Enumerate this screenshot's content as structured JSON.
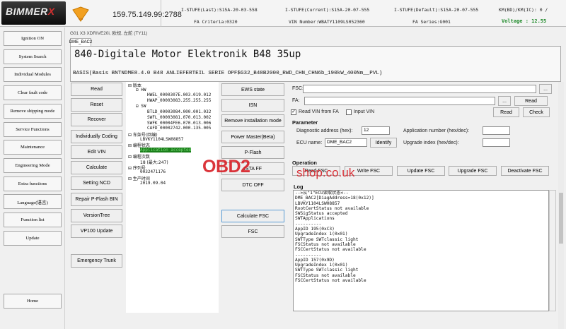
{
  "header": {
    "logo_text": "BIMMER",
    "logo_x": "X",
    "badge": "VIN",
    "ip": "159.75.149.99:2788",
    "istufe_last": "I-STUFE(Last):S15A-20-03-558",
    "istufe_current": "I-STUFE(Current):S15A-20-07-555",
    "istufe_default": "I-STUFE(Default):S15A-20-07-555",
    "km": "KM(BD)/KM(IC): 0 /",
    "fa_criteria": "FA Criteria:0320",
    "vin_number": "VIN Number:WBATY1109LS052360",
    "fa_series": "FA Series:G001",
    "voltage": "Voltage : 12.55"
  },
  "sidebar": {
    "items": [
      {
        "label": "Ignition ON"
      },
      {
        "label": "System Search"
      },
      {
        "label": "Individual Modules"
      },
      {
        "label": "Clear fault code"
      },
      {
        "label": "Remove shipping mode"
      },
      {
        "label": "Service Functions"
      },
      {
        "label": "Maintenance"
      },
      {
        "label": "Engineering Mode"
      },
      {
        "label": "Extra functions"
      },
      {
        "label": "Language(语言)"
      },
      {
        "label": "Function list"
      },
      {
        "label": "Update"
      },
      {
        "label": "Home"
      }
    ]
  },
  "vehicle": {
    "line": "G01 X3 XDRIVE20i, 欧规, 左舵 (TY11)",
    "tab": "DME_BAC2"
  },
  "ecu": {
    "title": "840-Digitale Motor Elektronik B48 35up",
    "basis": "BASIS(Basis BNTNDME8.4.0 B48 ANLIEFERTEIL SERIE OPF$G32_B48B2000_RWD_CHN_CHN6b_190kW_400Nm__PVL)"
  },
  "col1": {
    "buttons": [
      {
        "label": "Read"
      },
      {
        "label": "Reset"
      },
      {
        "label": "Recover"
      },
      {
        "label": "Individually Coding"
      },
      {
        "label": "Edit VIN"
      },
      {
        "label": "Calculate"
      },
      {
        "label": "Setting NCD"
      },
      {
        "label": "Repair P-Flash BIN"
      },
      {
        "label": "VersionTree"
      },
      {
        "label": "VP100 Update"
      },
      {
        "label": "Emergency Trunk"
      }
    ]
  },
  "tree": {
    "lines": [
      {
        "text": "⊟ 版本"
      },
      {
        "text": "⊟ HW"
      },
      {
        "text": "HWEL_0000307E.003.019.012"
      },
      {
        "text": "HWAP_00003083.255.255.255"
      },
      {
        "text": "⊟ SW"
      },
      {
        "text": "BTLD_00003084.000.001.032"
      },
      {
        "text": "SWFL_00003081.070.013.002"
      },
      {
        "text": "SWFK_00004FE6.070.013.006"
      },
      {
        "text": "CAFD_00002742.000.135.005"
      },
      {
        "text": "⊟ 车架号(回编)"
      },
      {
        "text": "LBVKY1104LSW08857"
      },
      {
        "text": "⊟ 编程状态"
      },
      {
        "text": "Application accepted"
      },
      {
        "text": "⊟ 编程次数"
      },
      {
        "text": "18 (最大:247)"
      },
      {
        "text": "⊟ 序列号"
      },
      {
        "text": "0032471176"
      },
      {
        "text": "⊟ 生产时间"
      },
      {
        "text": "2019.09.04"
      }
    ]
  },
  "col3": {
    "buttons": [
      {
        "label": "EWS state"
      },
      {
        "label": "ISN"
      },
      {
        "label": "Remove installation mode"
      },
      {
        "label": "Power Master(Beta)"
      },
      {
        "label": "P-Flash"
      },
      {
        "label": "ISTA FF"
      },
      {
        "label": "DTC OFF"
      },
      {
        "label": "Calculate FSC"
      },
      {
        "label": "FSC"
      }
    ]
  },
  "right": {
    "fsc_label": "FSC:",
    "fa_label": "FA:",
    "ellipsis": "...",
    "read": "Read",
    "check": "Check",
    "read_vin_fa": "Read VIN from FA",
    "input_vin": "Input VIN",
    "parameter": "Parameter",
    "diag_addr_label": "Diagnostic address (hex):",
    "diag_addr": "12",
    "app_num_label": "Application number (hex/dec):",
    "ecu_name_label": "ECU name:",
    "ecu_name": "DME_BAC2",
    "identify": "Identify",
    "upgrade_idx_label": "Upgrade index (hex/dec):",
    "operation": "Operation",
    "op_buttons": [
      {
        "label": "Read FSC"
      },
      {
        "label": "Write FSC"
      },
      {
        "label": "Update FSC"
      },
      {
        "label": "Upgrade FSC"
      },
      {
        "label": "Deactivate FSC"
      }
    ],
    "log_title": "Log"
  },
  "log": {
    "lines": [
      "-->从\"1\"ECU读取状态<--",
      "",
      "DME_BAC2[DiagAddress=18(0x12)]",
      "LBVKY1104LSW08857",
      "RootCertStatus not available",
      "SWSigStatus accepted",
      "SWTApplications",
      "",
      "----------",
      "AppID 195(0xC3)",
      "UpgradeIndex 1(0x01)",
      "SWTType SWTclassic light",
      "FSCStatus not available",
      "FSCCertStatus not available",
      "",
      "----------",
      "AppID 157(0x9D)",
      "UpgradeIndex 1(0x01)",
      "SWTType SWTclassic light",
      "FSCStatus not available",
      "FSCCertStatus not available"
    ]
  },
  "watermark": {
    "main": "OBD2",
    "sub": "shop.co.uk"
  },
  "colors": {
    "voltage": "#1f8a2a",
    "selected_tree_bg": "#1a7f1a",
    "watermark": "#d8232a"
  }
}
